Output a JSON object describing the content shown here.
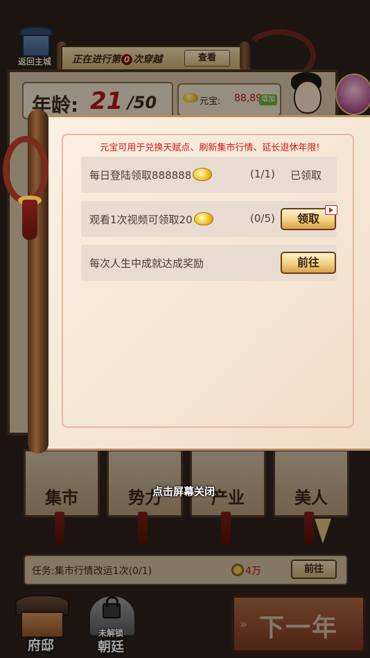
{
  "header": {
    "home_label": "返回主城",
    "progress_prefix": "正在进行第",
    "progress_count": "0",
    "progress_suffix": "次穿越",
    "view_button": "查看"
  },
  "status": {
    "age_label": "年龄:",
    "age_value": "21",
    "age_max": "/50",
    "ingot_label": "元宝:",
    "ingot_value": "88,89",
    "add_badge": "增加"
  },
  "modal": {
    "notice": "元宝可用于兑换天赋点、刷新集市行情、延长退休年限!",
    "rows": [
      {
        "text": "每日登陆领取888888",
        "progress": "(1/1)",
        "status": "已领取"
      },
      {
        "text": "观看1次视频可领取20",
        "progress": "(0/5)",
        "button": "领取"
      },
      {
        "text": "每次人生中成就达成奖励",
        "button": "前往"
      }
    ]
  },
  "cards": [
    {
      "label": "集市"
    },
    {
      "label": "势力"
    },
    {
      "label": "产业"
    },
    {
      "label": "美人"
    }
  ],
  "close_hint": "点击屏幕关闭",
  "task": {
    "text": "任务:集市行情改运1次(0/1)",
    "reward": "4万",
    "button": "前往"
  },
  "bottom_nav": {
    "mansion_label": "府邸",
    "court_locked": "未解锁",
    "court_label": "朝廷",
    "next_year_label": "下一年"
  },
  "colors": {
    "accent_red": "#d01818",
    "gold": "#f0c22a",
    "background": "#2b211c"
  }
}
